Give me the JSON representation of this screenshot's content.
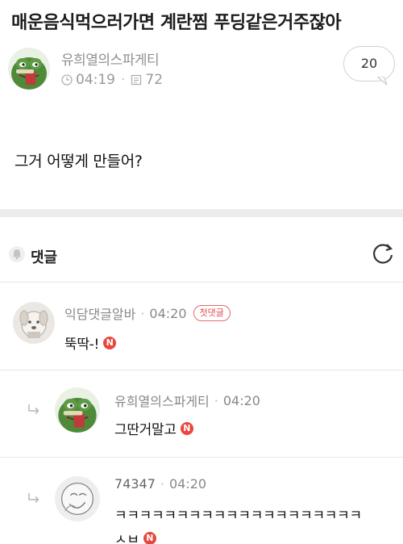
{
  "post": {
    "title": "매운음식먹으러가면 계란찜 푸딩같은거주잖아",
    "author": "유희열의스파게티",
    "time": "04:19",
    "views": "72",
    "comment_count": "20",
    "body": "그거 어떻게 만들어?"
  },
  "comments_section": {
    "label": "댓글"
  },
  "comments": [
    {
      "author": "익담댓글알바",
      "time": "04:20",
      "badge": "첫댓글",
      "text": "뚝딱-!",
      "new_mark": "N"
    },
    {
      "author": "유희열의스파게티",
      "time": "04:20",
      "text": "그딴거말고",
      "new_mark": "N"
    },
    {
      "author": "74347",
      "time": "04:20",
      "text_line1": "ㅋㅋㅋㅋㅋㅋㅋㅋㅋㅋㅋㅋㅋㅋㅋㅋㅋㅋㅋㅋ",
      "text_line2": "ㅅㅂ",
      "new_mark": "N"
    }
  ]
}
